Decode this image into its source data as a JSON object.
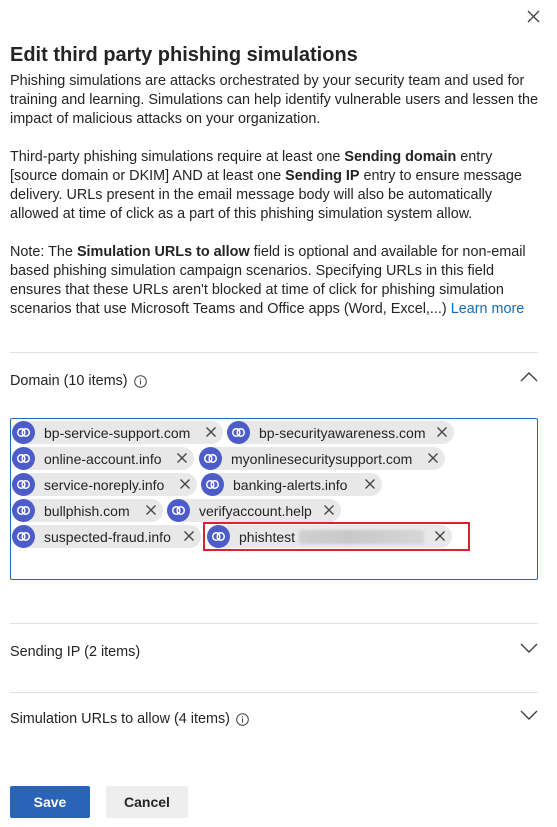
{
  "panel": {
    "title": "Edit third party phishing simulations",
    "intro": "Phishing simulations are attacks orchestrated by your security team and used for training and learning. Simulations can help identify vulnerable users and lessen the impact of malicious attacks on your organization.",
    "requirement": {
      "t1": "Third-party phishing simulations require at least one ",
      "b1": "Sending domain",
      "t2": " entry [source domain or DKIM] AND at least one ",
      "b2": "Sending IP",
      "t3": " entry to ensure message delivery. URLs present in the email message body will also be automatically allowed at time of click as a part of this phishing simulation system allow."
    },
    "note": {
      "t1": "Note: The ",
      "b1": "Simulation URLs to allow",
      "t2": " field is optional and available for non-email based phishing simulation campaign scenarios. Specifying URLs in this field ensures that these URLs aren't blocked at time of click for phishing simulation scenarios that use Microsoft Teams and Office apps (Word, Excel,...) ",
      "link": "Learn more"
    }
  },
  "sections": {
    "domain": {
      "title": "Domain (10 items)",
      "expanded": true,
      "items": [
        "bp-service-support.com",
        "bp-securityawareness.com",
        "online-account.info",
        "myonlinesecuritysupport.com",
        "service-noreply.info",
        "banking-alerts.info",
        "bullphish.com",
        "verifyaccount.help",
        "suspected-fraud.info",
        "phishtest"
      ]
    },
    "sending_ip": {
      "title": "Sending IP (2 items)",
      "expanded": false
    },
    "urls": {
      "title": "Simulation URLs to allow (4 items)",
      "expanded": false
    }
  },
  "buttons": {
    "save": "Save",
    "cancel": "Cancel"
  },
  "colors": {
    "accent": "#2a63b8",
    "tag_icon": "#4c5cc9",
    "highlight": "#d9232e"
  },
  "icons": [
    "close-icon",
    "info-icon",
    "chevron-up-icon",
    "chevron-down-icon",
    "link-icon",
    "remove-icon"
  ]
}
